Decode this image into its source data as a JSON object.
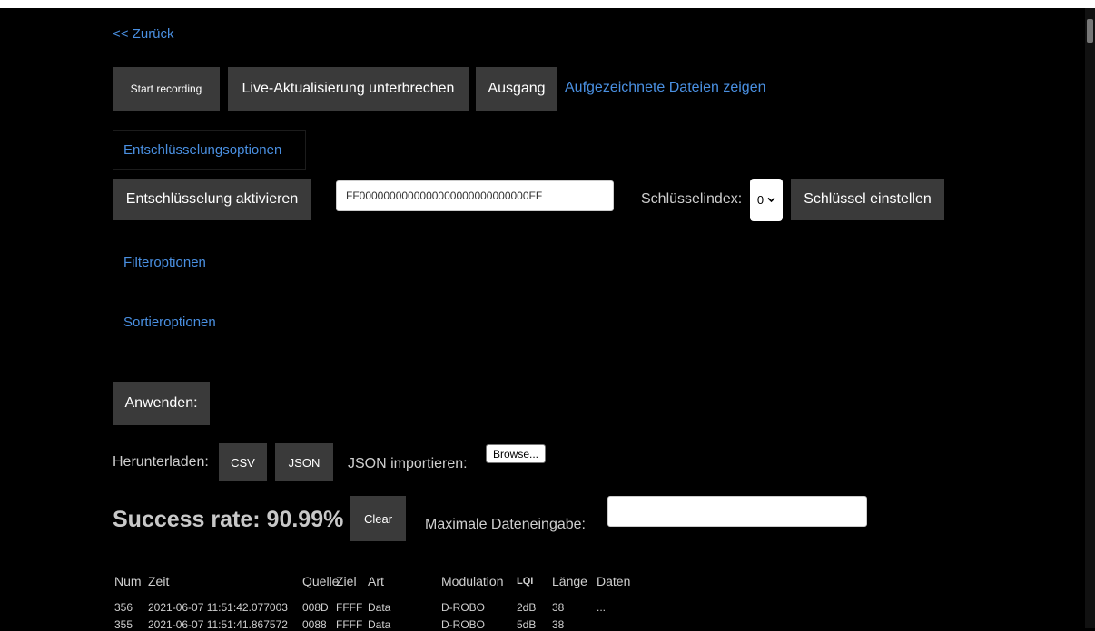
{
  "nav": {
    "back": "<< Zurück"
  },
  "toolbar": {
    "start_recording": "Start recording",
    "live_update": "Live-Aktualisierung unterbrechen",
    "exit": "Ausgang",
    "recorded_files": "Aufgezeichnete Dateien zeigen"
  },
  "decryption": {
    "section_label": "Entschlüsselungsoptionen",
    "enable_button": "Entschlüsselung aktivieren",
    "key_value": "FF0000000000000000000000000000FF",
    "key_index_label": "Schlüsselindex:",
    "key_index_selected": "0",
    "set_key_button": "Schlüssel einstellen"
  },
  "filter": {
    "label": "Filteroptionen"
  },
  "sort": {
    "label": "Sortieroptionen"
  },
  "apply": {
    "label": "Anwenden:"
  },
  "download": {
    "label": "Herunterladen:",
    "csv": "CSV",
    "json": "JSON",
    "import_label": "JSON importieren:",
    "browse": "Browse..."
  },
  "stats": {
    "success_rate": "Success rate: 90.99%",
    "clear": "Clear",
    "max_entries_label": "Maximale Dateneingabe:",
    "max_entries_value": ""
  },
  "table": {
    "headers": [
      "Num",
      "Zeit",
      "Quelle",
      "Ziel",
      "Art",
      "Modulation",
      "LQI",
      "Länge",
      "Daten"
    ],
    "rows": [
      [
        "356",
        "2021-06-07 11:51:42.077003",
        "008D",
        "FFFF",
        "Data",
        "D-ROBO",
        "2dB",
        "38",
        "..."
      ],
      [
        "355",
        "2021-06-07 11:51:41.867572",
        "0088",
        "FFFF",
        "Data",
        "D-ROBO",
        "5dB",
        "38",
        ""
      ]
    ]
  },
  "colors": {
    "background": "#000000",
    "link": "#4a90e2",
    "button": "#3a3a3a"
  }
}
